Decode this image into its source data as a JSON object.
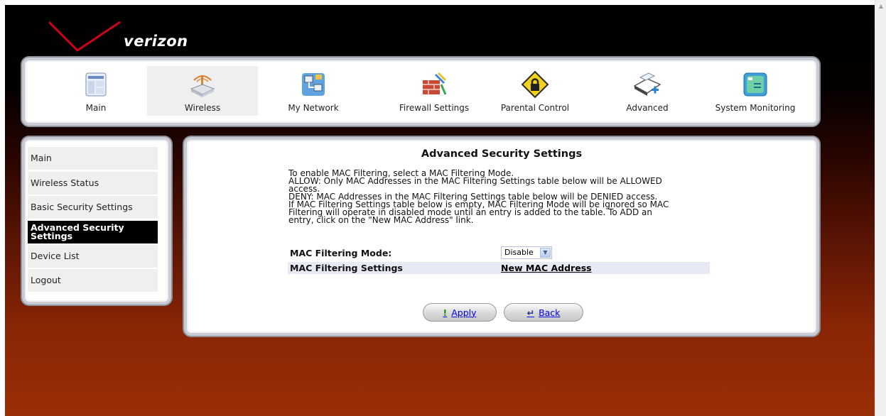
{
  "brand": {
    "logo_text": "verizon"
  },
  "topnav": {
    "items": [
      {
        "label": "Main",
        "icon": "main-page-icon"
      },
      {
        "label": "Wireless",
        "icon": "wireless-router-icon"
      },
      {
        "label": "My Network",
        "icon": "network-icon"
      },
      {
        "label": "Firewall Settings",
        "icon": "firewall-icon"
      },
      {
        "label": "Parental Control",
        "icon": "parental-control-icon"
      },
      {
        "label": "Advanced",
        "icon": "advanced-icon"
      },
      {
        "label": "System Monitoring",
        "icon": "system-monitoring-icon"
      }
    ],
    "active": "Wireless"
  },
  "sidebar": {
    "items": [
      {
        "label": "Main"
      },
      {
        "label": "Wireless Status"
      },
      {
        "label": "Basic Security Settings"
      },
      {
        "label": "Advanced Security Settings"
      },
      {
        "label": "Device List"
      },
      {
        "label": "Logout"
      }
    ],
    "active": "Advanced Security Settings"
  },
  "main": {
    "title": "Advanced Security Settings",
    "description_lines": [
      "To enable MAC Filtering, select a MAC Filtering Mode.",
      "ALLOW: Only MAC Addresses in the MAC Filtering Settings table below will be ALLOWED",
      "access.",
      "DENY: MAC Addresses in the MAC Filtering Settings table below will be DENIED access.",
      "If MAC Filtering Settings table below is empty, MAC Filtering Mode will be ignored so MAC",
      "Filtering will operate in disabled mode until an entry is added to the table. To ADD an",
      "entry, click on the \"New MAC Address\" link."
    ],
    "mode_label": "MAC Filtering Mode:",
    "mode_value": "Disable",
    "settings_label": "MAC Filtering Settings",
    "new_mac_link": "New MAC Address",
    "apply_label": "Apply",
    "back_label": "Back"
  },
  "colors": {
    "gradient_top": "#000000",
    "gradient_bottom": "#9b2e05",
    "panel_border": "#c9ccd3",
    "active_menu_bg": "#000000",
    "settings_row_bg": "#e7e9f5"
  }
}
